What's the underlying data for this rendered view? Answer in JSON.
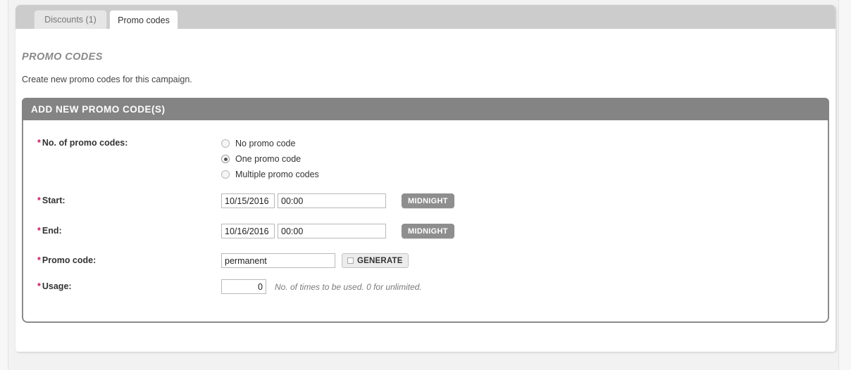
{
  "tabs": [
    {
      "label": "Discounts (1)",
      "active": false
    },
    {
      "label": "Promo codes",
      "active": true
    }
  ],
  "section": {
    "title": "PROMO CODES",
    "subtitle": "Create new promo codes for this campaign."
  },
  "panel": {
    "header": "ADD NEW PROMO CODE(S)",
    "rows": {
      "promo_count": {
        "label": "No. of promo codes:",
        "required_marker": "*",
        "options": [
          {
            "label": "No promo code",
            "selected": false
          },
          {
            "label": "One promo code",
            "selected": true
          },
          {
            "label": "Multiple promo codes",
            "selected": false
          }
        ]
      },
      "start": {
        "label": "Start:",
        "required_marker": "*",
        "date_value": "10/15/2016",
        "date_placeholder": "mm/dd/yyyy",
        "time_value": "00:00",
        "time_placeholder": "hh:mm",
        "button_label": "MIDNIGHT"
      },
      "end": {
        "label": "End:",
        "required_marker": "*",
        "date_value": "10/16/2016",
        "date_placeholder": "mm/dd/yyyy",
        "time_value": "00:00",
        "time_placeholder": "hh:mm",
        "button_label": "MIDNIGHT"
      },
      "promo_code": {
        "label": "Promo code:",
        "required_marker": "*",
        "value": "permanent",
        "placeholder": "",
        "button_label": "GENERATE"
      },
      "usage": {
        "label": "Usage:",
        "required_marker": "*",
        "value": "0",
        "placeholder": "",
        "hint": "No. of times to be used. 0 for unlimited."
      }
    }
  },
  "colors": {
    "accent_required": "#c2185b",
    "panel_header_bg": "#848484",
    "tabstrip_bg": "#cccccc",
    "page_bg": "#f2f2f2"
  }
}
